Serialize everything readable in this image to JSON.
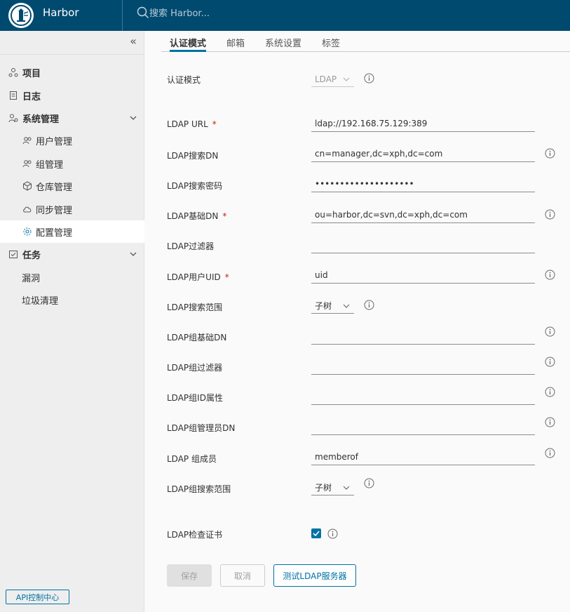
{
  "header": {
    "brand": "Harbor",
    "search_placeholder": "搜索 Harbor..."
  },
  "sidebar": {
    "items": [
      {
        "label": "项目"
      },
      {
        "label": "日志"
      },
      {
        "label": "系统管理"
      },
      {
        "label": "用户管理"
      },
      {
        "label": "组管理"
      },
      {
        "label": "仓库管理"
      },
      {
        "label": "同步管理"
      },
      {
        "label": "配置管理"
      },
      {
        "label": "任务"
      },
      {
        "label": "漏洞"
      },
      {
        "label": "垃圾清理"
      }
    ],
    "api_button": "API控制中心"
  },
  "tabs": [
    {
      "label": "认证模式"
    },
    {
      "label": "邮箱"
    },
    {
      "label": "系统设置"
    },
    {
      "label": "标签"
    }
  ],
  "form": {
    "auth_mode_label": "认证模式",
    "auth_mode_value": "LDAP",
    "fields": [
      {
        "label": "LDAP URL",
        "value": "ldap://192.168.75.129:389",
        "required": "*"
      },
      {
        "label": "LDAP搜索DN",
        "value": "cn=manager,dc=xph,dc=com"
      },
      {
        "label": "LDAP搜索密码",
        "value": "secretpassword123456"
      },
      {
        "label": "LDAP基础DN",
        "value": "ou=harbor,dc=svn,dc=xph,dc=com",
        "required": "*"
      },
      {
        "label": "LDAP过滤器",
        "value": ""
      },
      {
        "label": "LDAP用户UID",
        "value": "uid",
        "required": "*"
      },
      {
        "label": "LDAP搜索范围",
        "value": "子树"
      },
      {
        "label": "LDAP组基础DN",
        "value": ""
      },
      {
        "label": "LDAP组过滤器",
        "value": ""
      },
      {
        "label": "LDAP组ID属性",
        "value": ""
      },
      {
        "label": "LDAP组管理员DN",
        "value": ""
      },
      {
        "label": "LDAP 组成员",
        "value": "memberof"
      },
      {
        "label": "LDAP组搜索范围",
        "value": "子树"
      },
      {
        "label": "LDAP检查证书",
        "checked": true
      }
    ]
  },
  "buttons": {
    "save": "保存",
    "cancel": "取消",
    "test": "测试LDAP服务器"
  },
  "colors": {
    "header_bg": "#004a70",
    "accent": "#0072a3",
    "required": "#c92100"
  }
}
